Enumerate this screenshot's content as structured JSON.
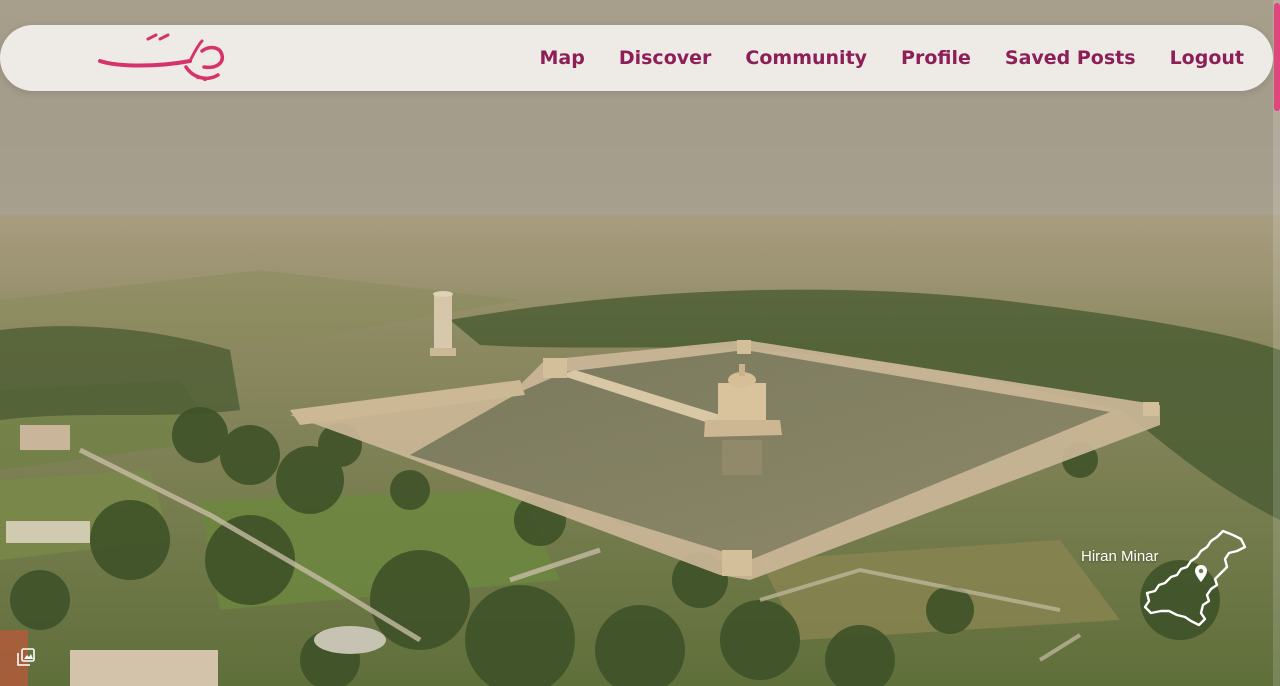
{
  "nav": {
    "logo_text": "سیاحت",
    "links": [
      "Map",
      "Discover",
      "Community",
      "Profile",
      "Saved Posts",
      "Logout"
    ]
  },
  "hero": {
    "location_name": "Hiran Minar",
    "map_icon": "pakistan-map-pin-icon",
    "gallery_icon": "gallery-icon"
  },
  "colors": {
    "brand": "#d6336c",
    "nav_text": "#8d1f58",
    "scrollbar": "#e0457b"
  }
}
